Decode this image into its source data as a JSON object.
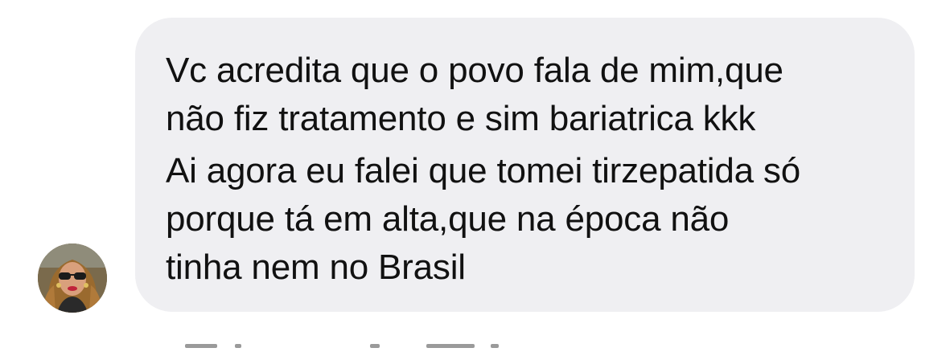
{
  "conversation": {
    "message": {
      "sender_avatar": "contact-avatar",
      "lines": [
        "Vc acredita que o povo fala de mim,que",
        "não fiz tratamento e sim bariatrica kkk",
        "Ai agora eu falei que tomei tirzepatida só",
        "porque tá em alta,que na época não",
        "tinha nem no Brasil"
      ]
    }
  },
  "colors": {
    "bubble_background": "#efeff2",
    "text": "#111111",
    "page_background": "#ffffff"
  }
}
